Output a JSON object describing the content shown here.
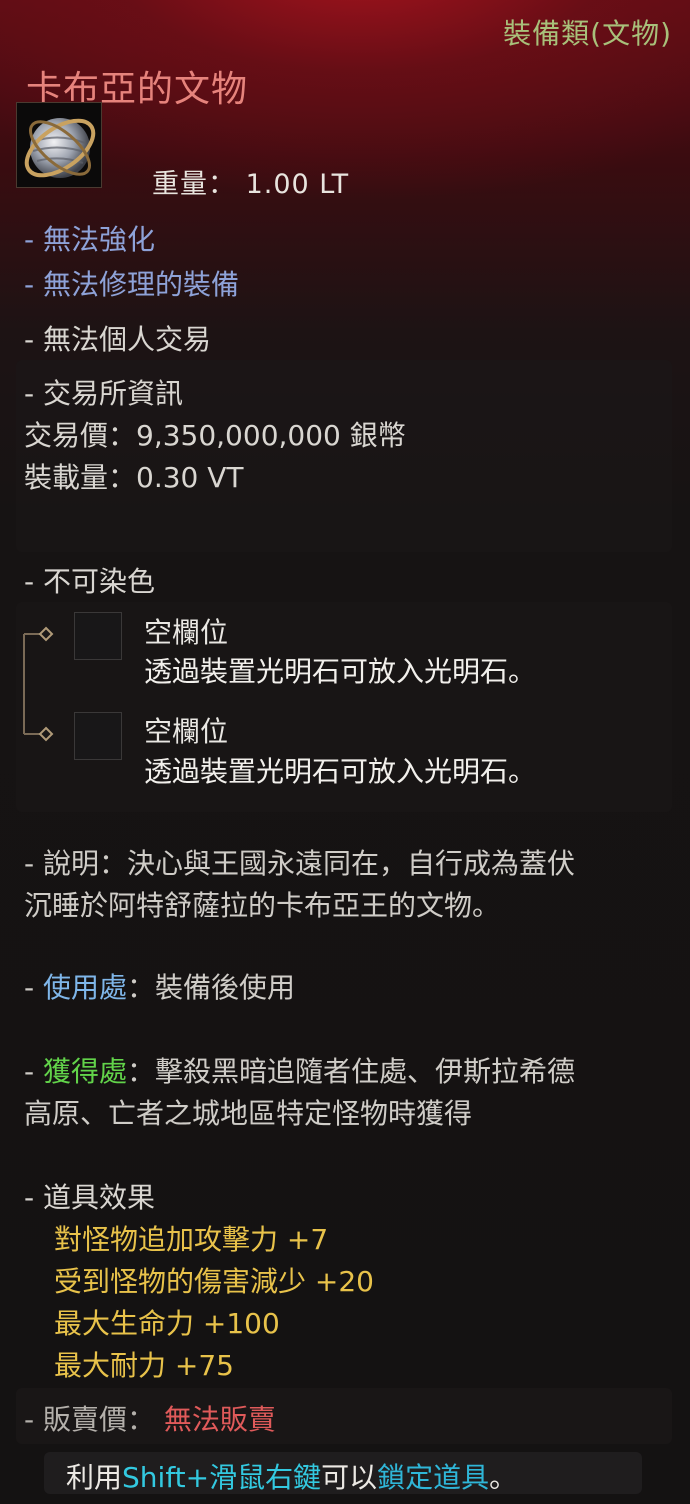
{
  "header": {
    "category": "裝備類(文物)",
    "item_name": "卡布亞的文物",
    "weight_label": "重量：",
    "weight_value": "1.00 LT"
  },
  "properties": {
    "no_enhance": "- 無法強化",
    "no_repair": "- 無法修理的裝備",
    "no_trade": "- 無法個人交易"
  },
  "market": {
    "title": "- 交易所資訊",
    "price_line": "交易價：9,350,000,000 銀幣",
    "load_line": "裝載量：0.30 VT"
  },
  "dye": "- 不可染色",
  "slots": [
    {
      "title": "空欄位",
      "desc": "透過裝置光明石可放入光明石。"
    },
    {
      "title": "空欄位",
      "desc": "透過裝置光明石可放入光明石。"
    }
  ],
  "description": {
    "line1": "- 說明：決心與王國永遠同在，自行成為蓋伏",
    "line2": "沉睡於阿特舒薩拉的卡布亞王的文物。"
  },
  "usage": {
    "dash": "- ",
    "label": "使用處",
    "value": "：裝備後使用"
  },
  "obtain": {
    "dash": "- ",
    "label": "獲得處",
    "value": "：擊殺黑暗追隨者住處、伊斯拉希德",
    "line2": "高原、亡者之城地區特定怪物時獲得"
  },
  "effects": {
    "title": "- 道具效果",
    "items": [
      "對怪物追加攻擊力 +7",
      "受到怪物的傷害減少 +20",
      "最大生命力 +100",
      "最大耐力 +75"
    ]
  },
  "sell": {
    "label": "- 販賣價：",
    "value": "無法販賣"
  },
  "footer": {
    "prefix": "利用",
    "key": "Shift+滑鼠右鍵",
    "middle": "可以",
    "action": "鎖定道具",
    "suffix": "。"
  },
  "colors": {
    "name": "#e6837c",
    "category": "#a8c07a",
    "property": "#8ea2d8",
    "effect": "#e8c24a",
    "usage_label": "#7fb6e9",
    "obtain_label": "#62d34a",
    "no_sell": "#e05a5a",
    "key_hint": "#33c9e0"
  }
}
